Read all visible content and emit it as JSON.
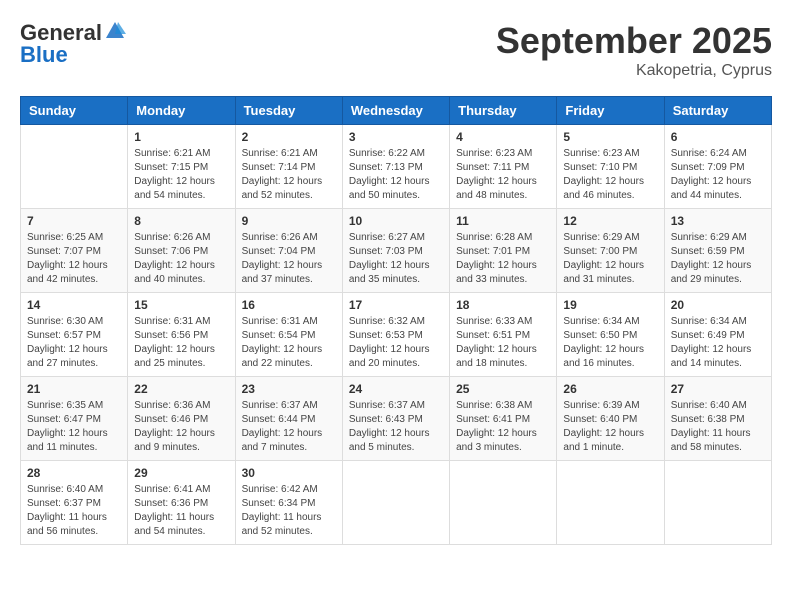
{
  "header": {
    "logo_general": "General",
    "logo_blue": "Blue",
    "month": "September 2025",
    "location": "Kakopetria, Cyprus"
  },
  "days_of_week": [
    "Sunday",
    "Monday",
    "Tuesday",
    "Wednesday",
    "Thursday",
    "Friday",
    "Saturday"
  ],
  "weeks": [
    [
      {
        "day": "",
        "sunrise": "",
        "sunset": "",
        "daylight": ""
      },
      {
        "day": "1",
        "sunrise": "6:21 AM",
        "sunset": "7:15 PM",
        "daylight": "12 hours and 54 minutes."
      },
      {
        "day": "2",
        "sunrise": "6:21 AM",
        "sunset": "7:14 PM",
        "daylight": "12 hours and 52 minutes."
      },
      {
        "day": "3",
        "sunrise": "6:22 AM",
        "sunset": "7:13 PM",
        "daylight": "12 hours and 50 minutes."
      },
      {
        "day": "4",
        "sunrise": "6:23 AM",
        "sunset": "7:11 PM",
        "daylight": "12 hours and 48 minutes."
      },
      {
        "day": "5",
        "sunrise": "6:23 AM",
        "sunset": "7:10 PM",
        "daylight": "12 hours and 46 minutes."
      },
      {
        "day": "6",
        "sunrise": "6:24 AM",
        "sunset": "7:09 PM",
        "daylight": "12 hours and 44 minutes."
      }
    ],
    [
      {
        "day": "7",
        "sunrise": "6:25 AM",
        "sunset": "7:07 PM",
        "daylight": "12 hours and 42 minutes."
      },
      {
        "day": "8",
        "sunrise": "6:26 AM",
        "sunset": "7:06 PM",
        "daylight": "12 hours and 40 minutes."
      },
      {
        "day": "9",
        "sunrise": "6:26 AM",
        "sunset": "7:04 PM",
        "daylight": "12 hours and 37 minutes."
      },
      {
        "day": "10",
        "sunrise": "6:27 AM",
        "sunset": "7:03 PM",
        "daylight": "12 hours and 35 minutes."
      },
      {
        "day": "11",
        "sunrise": "6:28 AM",
        "sunset": "7:01 PM",
        "daylight": "12 hours and 33 minutes."
      },
      {
        "day": "12",
        "sunrise": "6:29 AM",
        "sunset": "7:00 PM",
        "daylight": "12 hours and 31 minutes."
      },
      {
        "day": "13",
        "sunrise": "6:29 AM",
        "sunset": "6:59 PM",
        "daylight": "12 hours and 29 minutes."
      }
    ],
    [
      {
        "day": "14",
        "sunrise": "6:30 AM",
        "sunset": "6:57 PM",
        "daylight": "12 hours and 27 minutes."
      },
      {
        "day": "15",
        "sunrise": "6:31 AM",
        "sunset": "6:56 PM",
        "daylight": "12 hours and 25 minutes."
      },
      {
        "day": "16",
        "sunrise": "6:31 AM",
        "sunset": "6:54 PM",
        "daylight": "12 hours and 22 minutes."
      },
      {
        "day": "17",
        "sunrise": "6:32 AM",
        "sunset": "6:53 PM",
        "daylight": "12 hours and 20 minutes."
      },
      {
        "day": "18",
        "sunrise": "6:33 AM",
        "sunset": "6:51 PM",
        "daylight": "12 hours and 18 minutes."
      },
      {
        "day": "19",
        "sunrise": "6:34 AM",
        "sunset": "6:50 PM",
        "daylight": "12 hours and 16 minutes."
      },
      {
        "day": "20",
        "sunrise": "6:34 AM",
        "sunset": "6:49 PM",
        "daylight": "12 hours and 14 minutes."
      }
    ],
    [
      {
        "day": "21",
        "sunrise": "6:35 AM",
        "sunset": "6:47 PM",
        "daylight": "12 hours and 11 minutes."
      },
      {
        "day": "22",
        "sunrise": "6:36 AM",
        "sunset": "6:46 PM",
        "daylight": "12 hours and 9 minutes."
      },
      {
        "day": "23",
        "sunrise": "6:37 AM",
        "sunset": "6:44 PM",
        "daylight": "12 hours and 7 minutes."
      },
      {
        "day": "24",
        "sunrise": "6:37 AM",
        "sunset": "6:43 PM",
        "daylight": "12 hours and 5 minutes."
      },
      {
        "day": "25",
        "sunrise": "6:38 AM",
        "sunset": "6:41 PM",
        "daylight": "12 hours and 3 minutes."
      },
      {
        "day": "26",
        "sunrise": "6:39 AM",
        "sunset": "6:40 PM",
        "daylight": "12 hours and 1 minute."
      },
      {
        "day": "27",
        "sunrise": "6:40 AM",
        "sunset": "6:38 PM",
        "daylight": "11 hours and 58 minutes."
      }
    ],
    [
      {
        "day": "28",
        "sunrise": "6:40 AM",
        "sunset": "6:37 PM",
        "daylight": "11 hours and 56 minutes."
      },
      {
        "day": "29",
        "sunrise": "6:41 AM",
        "sunset": "6:36 PM",
        "daylight": "11 hours and 54 minutes."
      },
      {
        "day": "30",
        "sunrise": "6:42 AM",
        "sunset": "6:34 PM",
        "daylight": "11 hours and 52 minutes."
      },
      {
        "day": "",
        "sunrise": "",
        "sunset": "",
        "daylight": ""
      },
      {
        "day": "",
        "sunrise": "",
        "sunset": "",
        "daylight": ""
      },
      {
        "day": "",
        "sunrise": "",
        "sunset": "",
        "daylight": ""
      },
      {
        "day": "",
        "sunrise": "",
        "sunset": "",
        "daylight": ""
      }
    ]
  ]
}
